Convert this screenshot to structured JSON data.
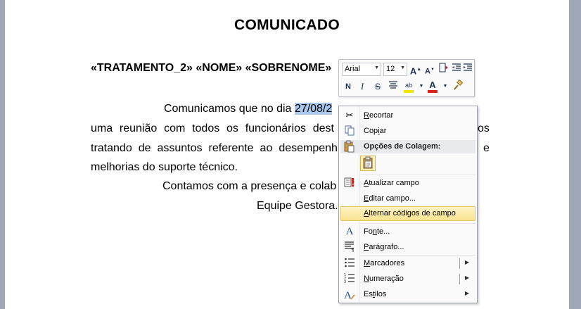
{
  "document": {
    "title": "COMUNICADO",
    "merge_fields": "«TRATAMENTO_2» «NOME» «SOBRENOME»",
    "para1_line1_start": "Comunicamos que no dia",
    "para1_line1_selected": "27/08/2",
    "para1_line2": [
      "uma",
      "reunião",
      "com",
      "todos",
      "os",
      "funcionários",
      "dest"
    ],
    "para1_line2_tail": "os",
    "para1_line3": [
      "tratando",
      "de",
      "assuntos",
      "referente",
      "ao",
      "desempenh"
    ],
    "para1_line3_tail": "e",
    "para1_line4": "melhorias do suporte técnico.",
    "para2": "Contamos com a presença e colab",
    "signature": "Equipe Gestora."
  },
  "mini_toolbar": {
    "font": "Arial",
    "size": "12",
    "bold": "N",
    "italic": "I",
    "strike": "S"
  },
  "context_menu": {
    "cut": {
      "pre": "",
      "u": "R",
      "post": "ecortar"
    },
    "copy": {
      "pre": "Cop",
      "u": "i",
      "post": "ar"
    },
    "paste_header": "Opções de Colagem:",
    "update_field": {
      "pre": "",
      "u": "A",
      "post": "tualizar campo"
    },
    "edit_field": {
      "pre": "",
      "u": "E",
      "post": "ditar campo..."
    },
    "toggle_codes": {
      "pre": "",
      "u": "A",
      "post": "lternar códigos de campo"
    },
    "font": {
      "pre": "Fo",
      "u": "n",
      "post": "te..."
    },
    "paragraph": {
      "pre": "",
      "u": "P",
      "post": "arágrafo..."
    },
    "bullets": {
      "pre": "",
      "u": "M",
      "post": "arcadores"
    },
    "numbering": {
      "pre": "",
      "u": "N",
      "post": "umeração"
    },
    "styles": {
      "pre": "Es",
      "u": "t",
      "post": "ilos"
    }
  },
  "colors": {
    "selection": "#a9c8ec",
    "hover_top": "#fdf3c6",
    "hover_bottom": "#fbe38f",
    "highlight_yellow": "#f2e600",
    "font_color_red": "#d8231c"
  }
}
